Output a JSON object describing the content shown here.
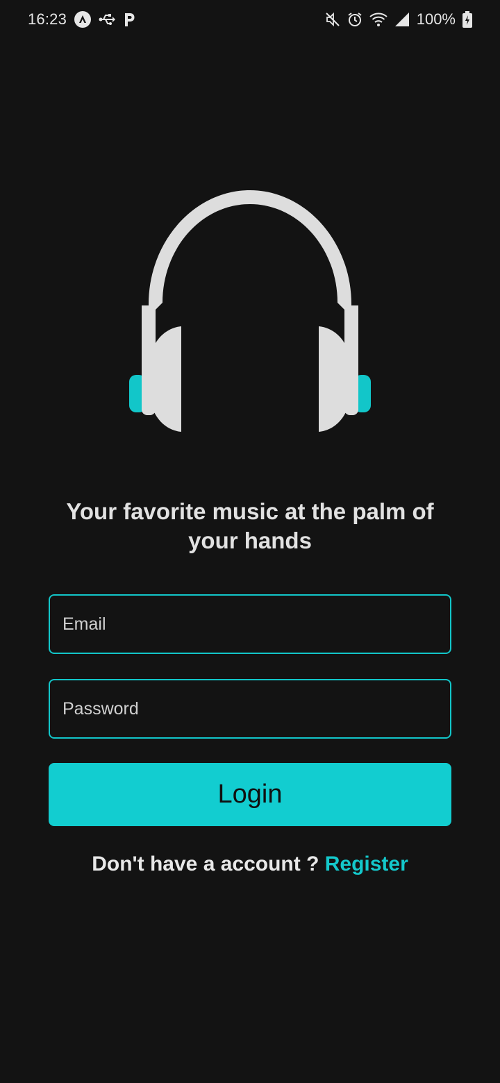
{
  "status_bar": {
    "time": "16:23",
    "battery": "100%",
    "icons_left": [
      "android-auto-icon",
      "usb-icon",
      "parking-app-icon"
    ],
    "icons_right": [
      "mute-icon",
      "alarm-icon",
      "wifi-icon",
      "signal-icon",
      "battery-charging-icon"
    ]
  },
  "logo": {
    "icon": "headphones-icon",
    "color": "#dddddd",
    "accent_color": "#12c6c9"
  },
  "tagline": "Your favorite music at the palm of your hands",
  "form": {
    "email": {
      "placeholder": "Email",
      "value": ""
    },
    "password": {
      "placeholder": "Password",
      "value": ""
    },
    "login_label": "Login"
  },
  "register": {
    "prompt": "Don't have a account ?",
    "link_label": "Register"
  },
  "colors": {
    "background": "#131313",
    "accent": "#12cdd0",
    "text": "#e0e0e0"
  }
}
